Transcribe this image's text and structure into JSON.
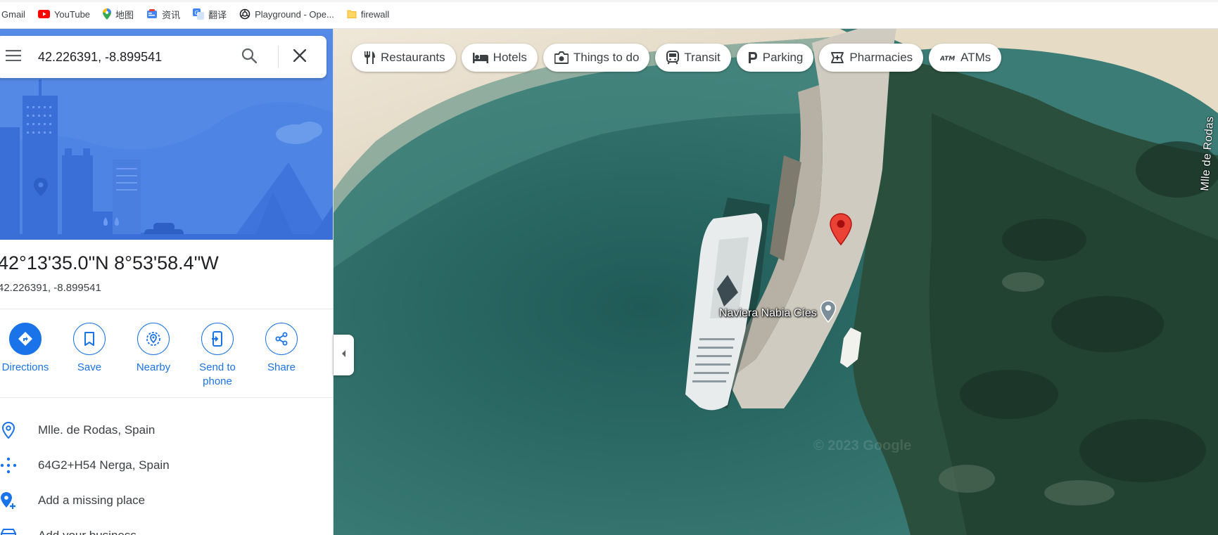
{
  "bookmarks": [
    {
      "label": "Gmail",
      "icon": "gmail-icon"
    },
    {
      "label": "YouTube",
      "icon": "youtube-icon"
    },
    {
      "label": "地图",
      "icon": "maps-icon"
    },
    {
      "label": "资讯",
      "icon": "news-icon"
    },
    {
      "label": "翻译",
      "icon": "translate-icon"
    },
    {
      "label": "Playground - Ope...",
      "icon": "openai-icon"
    },
    {
      "label": "firewall",
      "icon": "folder-icon"
    }
  ],
  "search": {
    "query": "42.226391, -8.899541",
    "search_icon": "search-icon",
    "close_icon": "close-icon",
    "menu_icon": "menu-icon"
  },
  "place": {
    "title": "42°13'35.0\"N 8°53'58.4\"W",
    "subtitle": "42.226391, -8.899541"
  },
  "actions": [
    {
      "label": "Directions",
      "icon": "directions-icon"
    },
    {
      "label": "Save",
      "icon": "bookmark-icon"
    },
    {
      "label": "Nearby",
      "icon": "nearby-icon"
    },
    {
      "label": "Send to phone",
      "icon": "send-to-phone-icon"
    },
    {
      "label": "Share",
      "icon": "share-icon"
    }
  ],
  "info": [
    {
      "text": "Mlle. de Rodas, Spain",
      "icon": "location-pin-icon"
    },
    {
      "text": "64G2+H54 Nerga, Spain",
      "icon": "plus-code-icon"
    },
    {
      "text": "Add a missing place",
      "icon": "add-place-icon"
    },
    {
      "text": "Add your business",
      "icon": "business-icon"
    }
  ],
  "chips": [
    {
      "label": "Restaurants",
      "icon": "restaurant-icon"
    },
    {
      "label": "Hotels",
      "icon": "hotel-icon"
    },
    {
      "label": "Things to do",
      "icon": "camera-icon"
    },
    {
      "label": "Transit",
      "icon": "transit-icon"
    },
    {
      "label": "Parking",
      "icon": "parking-icon"
    },
    {
      "label": "Pharmacies",
      "icon": "pharmacy-icon"
    },
    {
      "label": "ATMs",
      "icon": "atm-icon"
    }
  ],
  "map": {
    "poi_label": "Naviera Nabia Cíes",
    "street_label": "Mlle de Rodas",
    "watermark": "© 2023 Google"
  },
  "colors": {
    "accent": "#1a73e8",
    "hero": "#4f86e6",
    "pin": "#ea4335",
    "water": "#2f6e6a"
  }
}
